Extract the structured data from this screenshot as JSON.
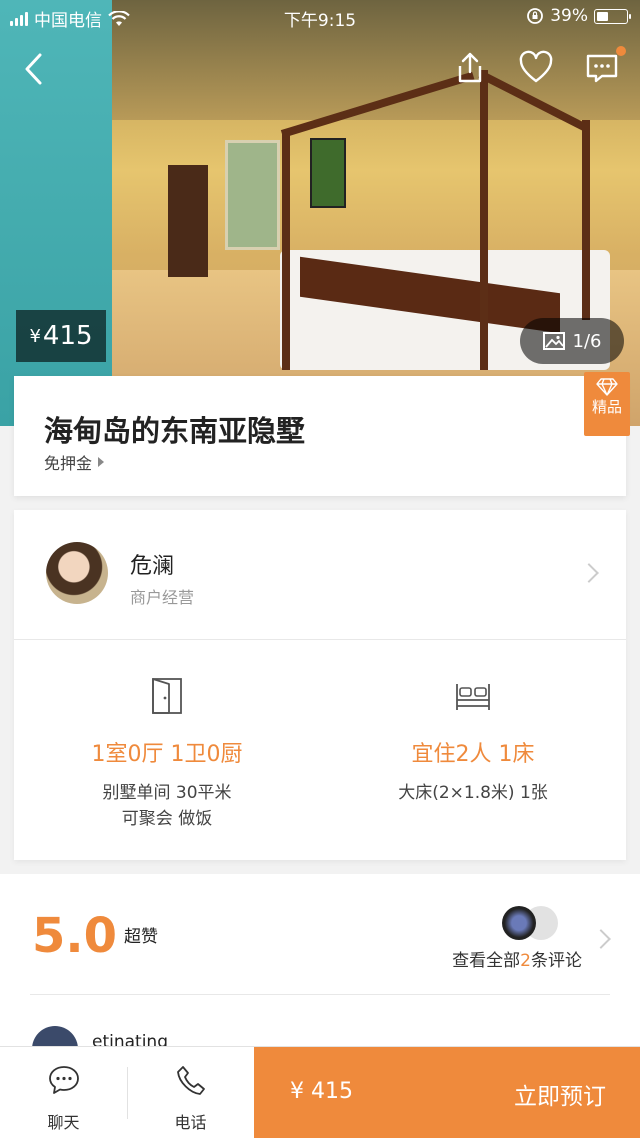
{
  "status_bar": {
    "carrier": "中国电信",
    "time": "下午9:15",
    "battery": "39%",
    "battery_level": 0.39
  },
  "hero": {
    "price_currency": "¥",
    "price": "415",
    "photo_counter": "1/6"
  },
  "listing": {
    "title": "海甸岛的东南亚隐墅",
    "deposit_label": "免押金",
    "badge_label": "精品"
  },
  "host": {
    "name": "危澜",
    "role": "商户经营"
  },
  "specs": {
    "rooms": {
      "main": "1室0厅 1卫0厨",
      "line1": "别墅单间 30平米",
      "line2": "可聚会 做饭"
    },
    "beds": {
      "main": "宜住2人 1床",
      "line1": "大床(2×1.8米) 1张"
    }
  },
  "reviews": {
    "score": "5.0",
    "score_label": "超赞",
    "link_prefix": "查看全部",
    "link_count": "2",
    "link_suffix": "条评论",
    "first_reviewer": "etinating"
  },
  "bottom_bar": {
    "chat_label": "聊天",
    "phone_label": "电话",
    "price": "¥ 415",
    "book_label": "立即预订"
  },
  "colors": {
    "accent": "#ef8a3c"
  }
}
